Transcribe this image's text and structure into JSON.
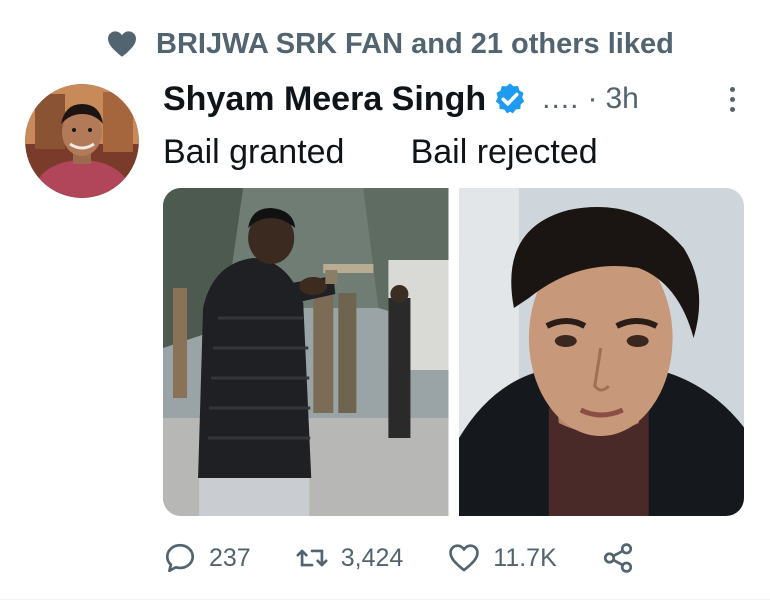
{
  "social_context": {
    "icon": "heart-icon",
    "text": "BRIJWA SRK FAN and 21 others liked"
  },
  "tweet": {
    "author": {
      "name": "Shyam Meera Singh",
      "verified": true
    },
    "ellipsis": "....",
    "separator": "·",
    "time": "3h",
    "text": "Bail granted       Bail rejected",
    "media": [
      {
        "description_icon": "photo-man-pointing-gun"
      },
      {
        "description_icon": "photo-young-man-portrait"
      }
    ],
    "actions": {
      "reply_count": "237",
      "retweet_count": "3,424",
      "like_count": "11.7K"
    }
  },
  "colors": {
    "text_primary": "#0f1419",
    "text_secondary": "#536471",
    "verified_blue": "#1d9bf0"
  }
}
